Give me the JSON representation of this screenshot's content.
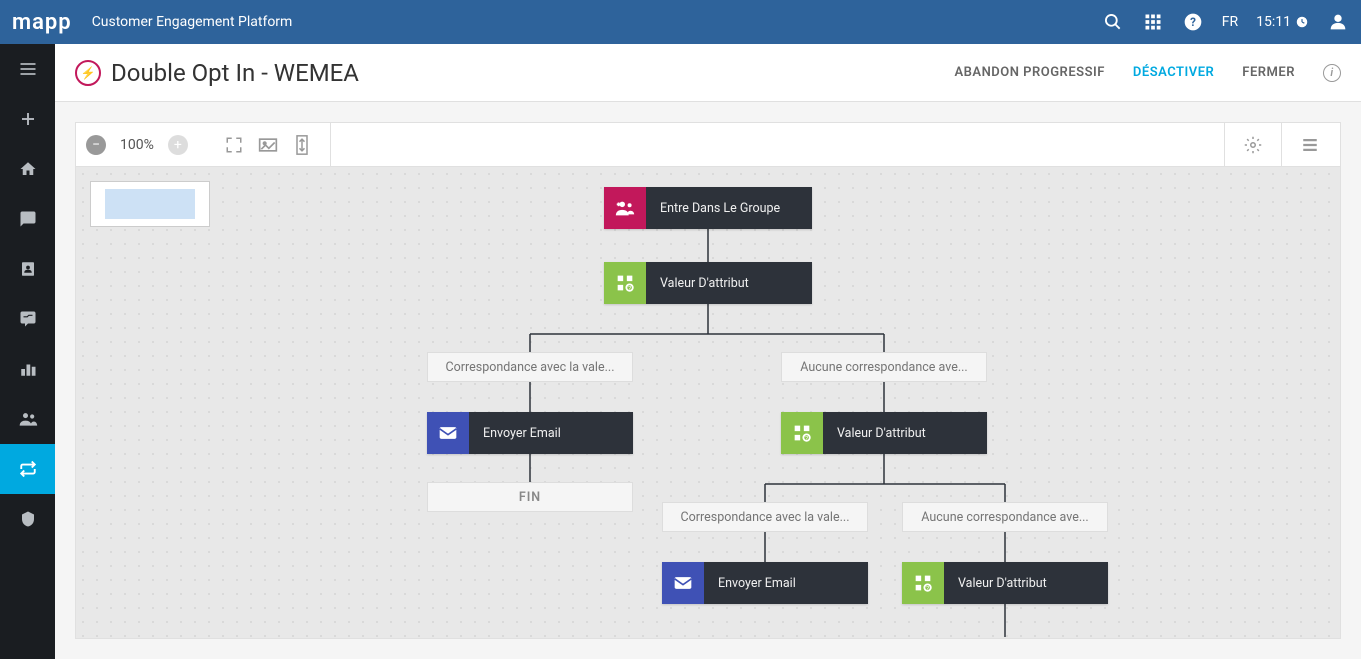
{
  "header": {
    "logo": "mapp",
    "product": "Customer Engagement Platform",
    "language": "FR",
    "time": "15:11"
  },
  "page": {
    "title": "Double Opt In - WEMEA",
    "actions": {
      "abandon": "ABANDON PROGRESSIF",
      "deactivate": "DÉSACTIVER",
      "close": "FERMER"
    }
  },
  "toolbar": {
    "zoom": "100%"
  },
  "flow": {
    "nodes": {
      "start": "Entre Dans Le Groupe",
      "attr1": "Valeur D'attribut",
      "branch_match": "Correspondance avec la vale...",
      "branch_nomatch": "Aucune correspondance ave...",
      "email1": "Envoyer Email",
      "end": "FIN",
      "attr2": "Valeur D'attribut",
      "branch_match2": "Correspondance avec la vale...",
      "branch_nomatch2": "Aucune correspondance ave...",
      "email2": "Envoyer Email",
      "attr3": "Valeur D'attribut"
    }
  }
}
